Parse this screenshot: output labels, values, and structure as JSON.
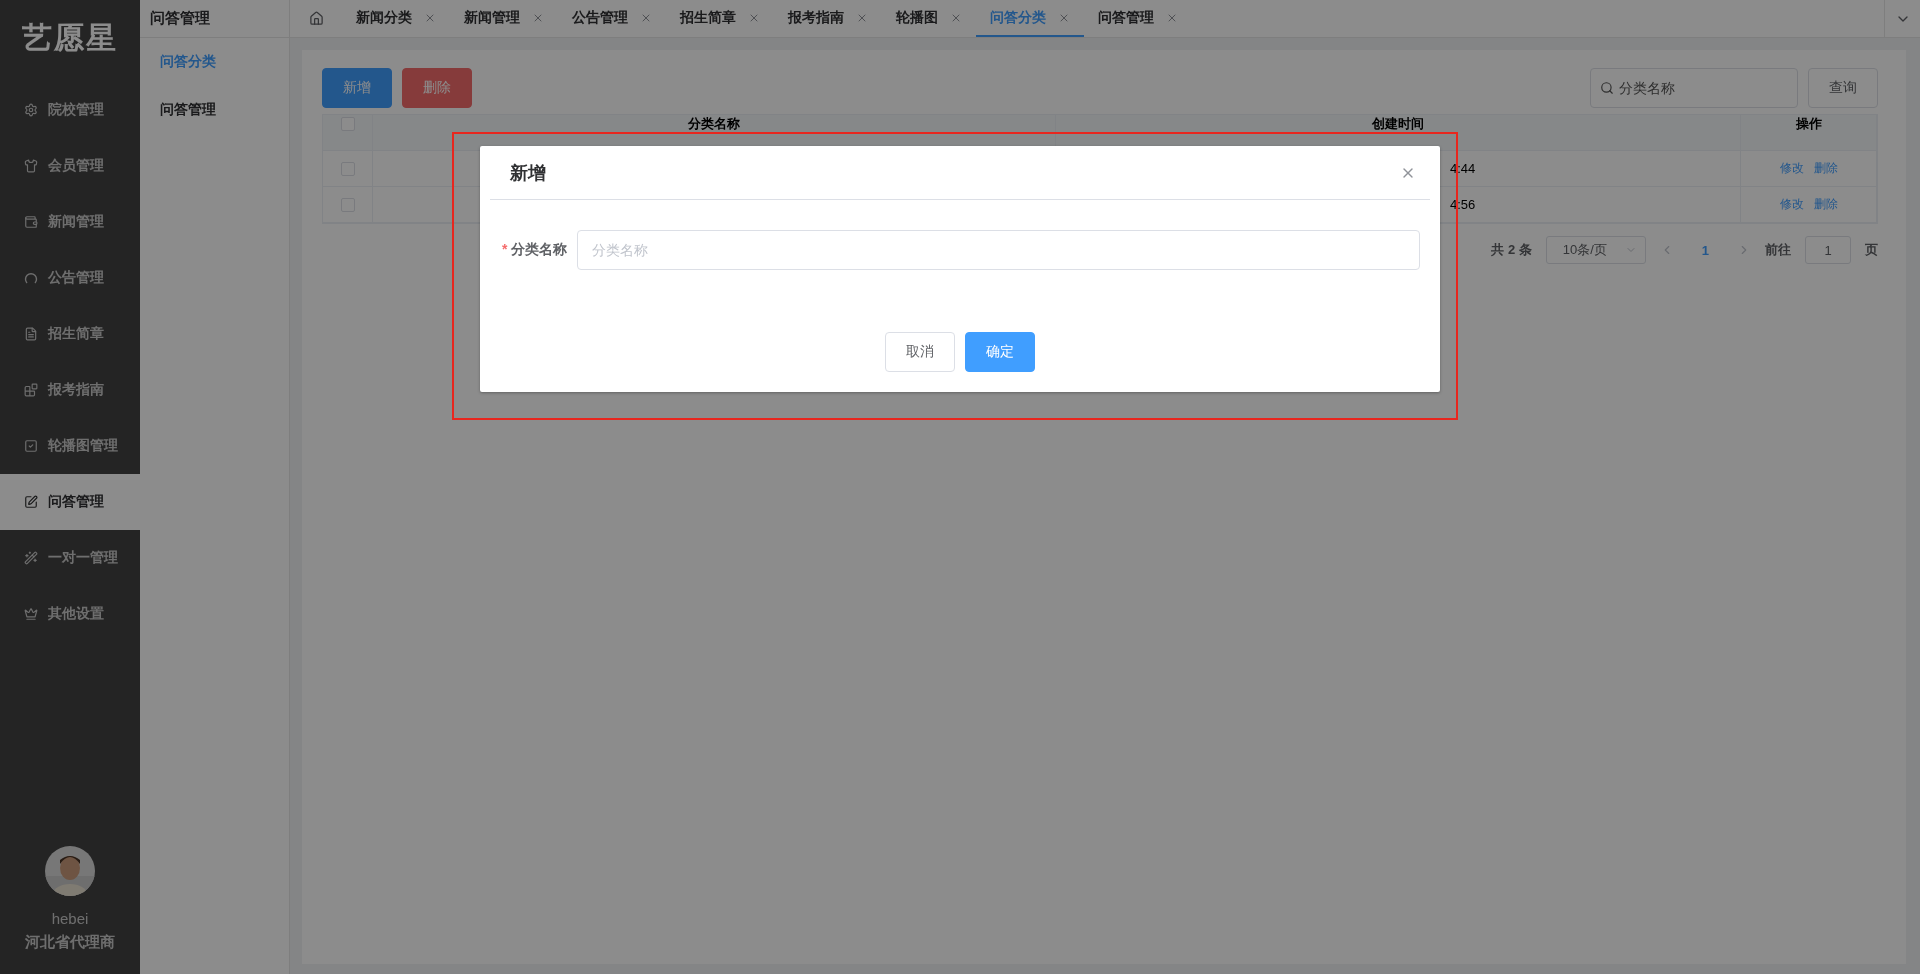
{
  "sidebar": {
    "logo": "艺愿星",
    "items": [
      {
        "label": "院校管理",
        "selected": false
      },
      {
        "label": "会员管理",
        "selected": false
      },
      {
        "label": "新闻管理",
        "selected": false
      },
      {
        "label": "公告管理",
        "selected": false
      },
      {
        "label": "招生简章",
        "selected": false
      },
      {
        "label": "报考指南",
        "selected": false
      },
      {
        "label": "轮播图管理",
        "selected": false
      },
      {
        "label": "问答管理",
        "selected": true
      },
      {
        "label": "一对一管理",
        "selected": false
      },
      {
        "label": "其他设置",
        "selected": false
      }
    ],
    "user": {
      "name": "hebei",
      "role": "河北省代理商"
    }
  },
  "submenu": {
    "title": "问答管理",
    "items": [
      {
        "label": "问答分类",
        "selected": true
      },
      {
        "label": "问答管理",
        "selected": false
      }
    ]
  },
  "tabs": [
    {
      "label": "新闻分类",
      "selected": false
    },
    {
      "label": "新闻管理",
      "selected": false
    },
    {
      "label": "公告管理",
      "selected": false
    },
    {
      "label": "招生简章",
      "selected": false
    },
    {
      "label": "报考指南",
      "selected": false
    },
    {
      "label": "轮播图",
      "selected": false
    },
    {
      "label": "问答分类",
      "selected": true
    },
    {
      "label": "问答管理",
      "selected": false
    }
  ],
  "toolbar": {
    "buttons": [
      {
        "label": "新增",
        "kind": "primary"
      },
      {
        "label": "删除",
        "kind": "danger"
      }
    ],
    "search": {
      "placeholder": "分类名称"
    },
    "query_button": "查询"
  },
  "table": {
    "header_checked": false,
    "columns": [
      "分类名称",
      "创建时间",
      "操作"
    ],
    "rows": [
      {
        "checked": false,
        "column_2": "4:44",
        "actions": [
          "修改",
          "删除"
        ]
      },
      {
        "checked": false,
        "column_2": "4:56",
        "actions": [
          "修改",
          "删除"
        ]
      }
    ]
  },
  "pagination": {
    "total": "共 2 条",
    "page_size": "10条/页",
    "pages": [
      {
        "label": "1",
        "selected": true
      }
    ],
    "goto_label": "前往",
    "goto_value": "1",
    "goto_suffix": "页"
  },
  "dialog": {
    "title": "新增",
    "field": {
      "required_mark": "*",
      "label": "分类名称",
      "placeholder": "分类名称"
    },
    "buttons": [
      {
        "label": "取消",
        "kind": "default"
      },
      {
        "label": "确定",
        "kind": "primary"
      }
    ]
  }
}
